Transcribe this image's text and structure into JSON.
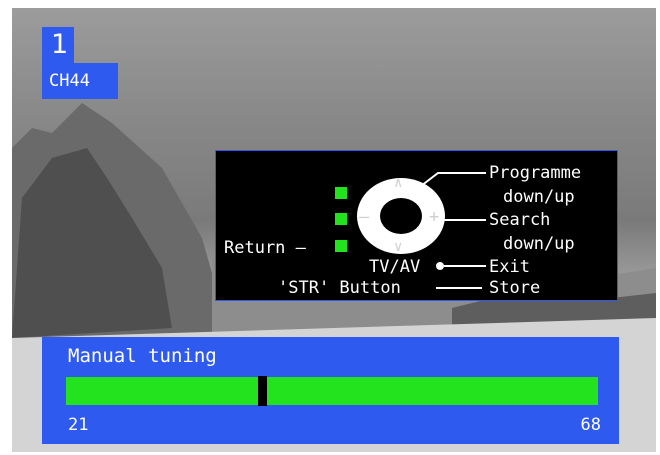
{
  "osd": {
    "programme_number": "1",
    "channel": "CH44"
  },
  "help_panel": {
    "programme_label": "Programme",
    "programme_sub": "down/up",
    "search_label": "Search",
    "search_sub": "down/up",
    "return_label": "Return –",
    "tvav_label": "TV/AV",
    "exit_label": "Exit",
    "str_label": "'STR' Button",
    "store_label": "Store",
    "pad_up": "∧",
    "pad_down": "∨",
    "pad_left": "–",
    "pad_right": "+"
  },
  "tuning": {
    "title": "Manual tuning",
    "min": "21",
    "max": "68",
    "position_fraction": 0.37
  },
  "colors": {
    "osd_blue": "#2f5af0",
    "green": "#22e31e"
  }
}
